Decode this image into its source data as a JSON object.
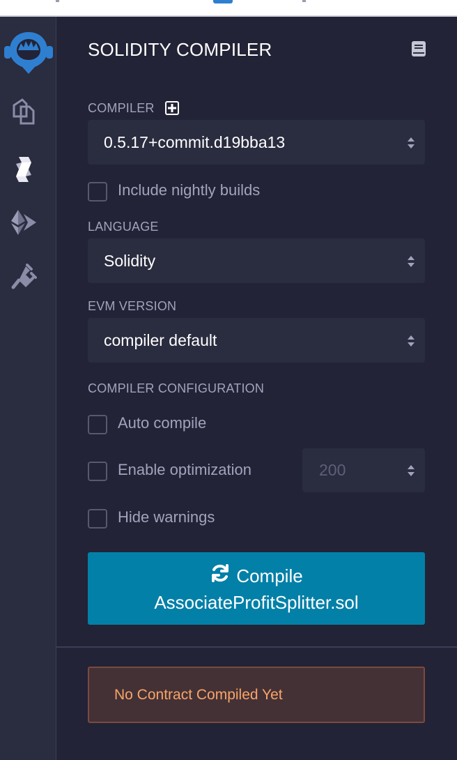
{
  "header": {
    "title": "SOLIDITY COMPILER",
    "docs_icon": "book-icon"
  },
  "icon_bar": [
    {
      "name": "remix-logo-icon"
    },
    {
      "name": "file-explorers-icon"
    },
    {
      "name": "solidity-compiler-icon"
    },
    {
      "name": "deploy-run-icon"
    },
    {
      "name": "plugin-manager-icon"
    }
  ],
  "compiler": {
    "label": "COMPILER",
    "add_icon": "plus-square-icon",
    "selected": "0.5.17+commit.d19bba13",
    "nightly_label": "Include nightly builds",
    "nightly_checked": false
  },
  "language": {
    "label": "LANGUAGE",
    "selected": "Solidity"
  },
  "evm": {
    "label": "EVM VERSION",
    "selected": "compiler default"
  },
  "config": {
    "label": "COMPILER CONFIGURATION",
    "auto_compile_label": "Auto compile",
    "auto_compile_checked": false,
    "optimization_label": "Enable optimization",
    "optimization_checked": false,
    "runs_value": "200",
    "hide_warnings_label": "Hide warnings",
    "hide_warnings_checked": false
  },
  "compile_button": {
    "icon": "refresh-icon",
    "line1": "Compile",
    "line2": "AssociateProfitSplitter.sol"
  },
  "status": {
    "message": "No Contract Compiled Yet"
  },
  "colors": {
    "background": "#222336",
    "sidebar": "#2a2c3f",
    "primary": "#0380a8",
    "warning_text": "#f8a567",
    "logo_blue": "#2f7fd1"
  }
}
